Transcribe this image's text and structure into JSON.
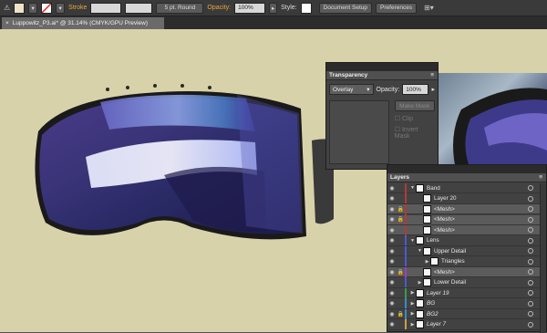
{
  "control_bar": {
    "stroke_label": "Stroke",
    "brush": "5 pt. Round",
    "opacity_label": "Opacity:",
    "opacity_value": "100%",
    "style_label": "Style:",
    "document_setup": "Document Setup",
    "preferences": "Preferences"
  },
  "document_tab": {
    "title": "Luppowitz_P3.ai* @ 31.14% (CMYK/GPU Preview)",
    "close": "×"
  },
  "transparency_panel": {
    "title": "Transparency",
    "blend_mode": "Overlay",
    "opacity_label": "Opacity:",
    "opacity_value": "100%",
    "make_mask": "Make Mask",
    "clip": "Clip",
    "invert_mask": "Invert Mask"
  },
  "layers_panel": {
    "title": "Layers",
    "rows": [
      {
        "name": "Band",
        "indent": 0
      },
      {
        "name": "Layer 20",
        "indent": 1
      },
      {
        "name": "<Mesh>",
        "indent": 1
      },
      {
        "name": "<Mesh>",
        "indent": 1
      },
      {
        "name": "<Mesh>",
        "indent": 1
      },
      {
        "name": "Lens",
        "indent": 0
      },
      {
        "name": "Upper Detail",
        "indent": 1
      },
      {
        "name": "Triangles",
        "indent": 2
      },
      {
        "name": "<Mesh>",
        "indent": 1
      },
      {
        "name": "Lower Detail",
        "indent": 1
      },
      {
        "name": "Layer 19",
        "indent": 0
      },
      {
        "name": "BG",
        "indent": 0
      },
      {
        "name": "BG2",
        "indent": 0
      },
      {
        "name": "Layer 7",
        "indent": 0
      }
    ]
  },
  "colors": {
    "canvas": "#d8d2aa",
    "accent": "#e8a640"
  }
}
